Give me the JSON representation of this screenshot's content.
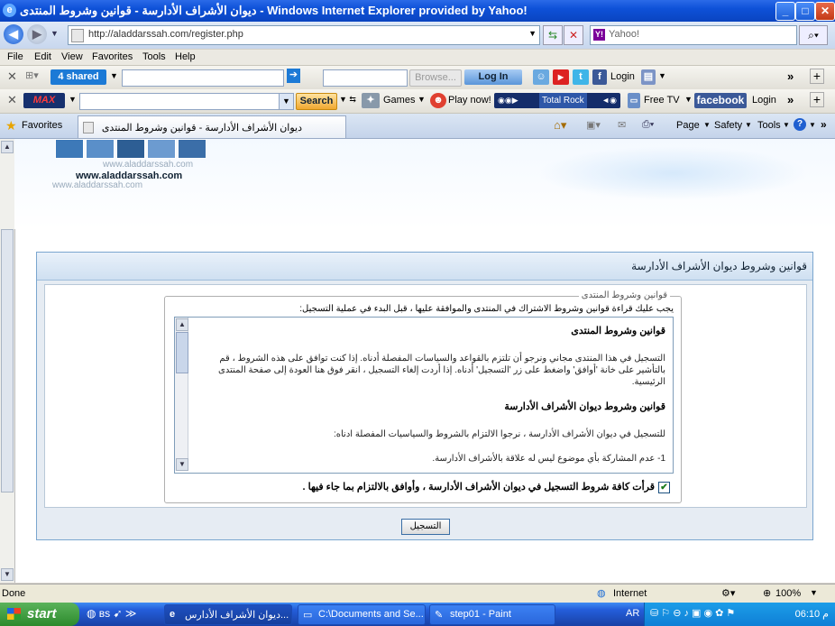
{
  "window": {
    "title": "ديوان الأشراف الأدارسة - قوانين وشروط المنتدى - Windows Internet Explorer provided by Yahoo!",
    "buttons": {
      "minimize": "_",
      "maximize": "□",
      "close": "✕"
    }
  },
  "address_bar": {
    "url": "http://aladdarssah.com/register.php",
    "search_placeholder": "Yahoo!"
  },
  "menu": [
    "File",
    "Edit",
    "View",
    "Favorites",
    "Tools",
    "Help"
  ],
  "toolbar_4shared": {
    "brand": "4 shared",
    "browse": "Browse...",
    "login": "Log In",
    "login_right": "Login"
  },
  "toolbar_max": {
    "brand": "MAX",
    "search": "Search",
    "games": "Games",
    "play_now": "Play now!",
    "radio": "Total Rock",
    "free_tv": "Free TV",
    "facebook": "facebook",
    "login": "Login"
  },
  "favorites_bar": {
    "favorites_label": "Favorites",
    "tab_title": "ديوان الأشراف الأدارسة - قوانين وشروط المنتدى",
    "tools": [
      "Page",
      "Safety",
      "Tools"
    ]
  },
  "banner": {
    "watermark": "www.aladdarssah.com"
  },
  "forum": {
    "panel_title": "قوانين وشروط ديوان الأشراف الأدارسة",
    "legend": "قوانين وشروط المنتدى",
    "intro": "يجب عليك قراءة قوانين وشروط الاشتراك في المنتدى والموافقة عليها ، قبل البدء في عملية التسجيل:",
    "rules_heading_1": "قوانين وشروط المنتدى",
    "rules_para_1": "التسجيل في هذا المنتدى مجاني ونرجو أن تلتزم بالقواعد والسياسات المفصلة أدناه. إذا كنت توافق على هذه الشروط ، قم بالتأشير على خانة 'أوافق' واضغط على زر 'التسجيل' أدناه. إذا أردت إلغاء التسجيل ، انقر فوق هنا العودة إلى صفحة المنتدى الرئيسية.",
    "rules_heading_2": "قوانين وشروط ديوان الأشراف الأدارسة",
    "rules_para_2": "للتسجيل في ديوان الأشراف الأدارسة ، نرجوا الالتزام بالشروط والسياسيات المفصلة ادناه:",
    "rules_para_3": "1- عدم المشاركة بأي موضوع ليس له علاقة بالأشراف الأدارسة.",
    "agree_label": "قرأت كافة شروط التسجيل في ديوان الأشراف الأدارسة ، وأوافق بالالتزام بما جاء فيها .",
    "agree_checked": true,
    "register_button": "التسجيل"
  },
  "status_bar": {
    "status": "Done",
    "zone": "Internet",
    "zoom": "100%"
  },
  "taskbar": {
    "start": "start",
    "tasks": [
      "ديوان الأشراف الأدارس...",
      "C:\\Documents and Se...",
      "step01 - Paint"
    ],
    "language": "AR",
    "clock": "م 06:10"
  }
}
